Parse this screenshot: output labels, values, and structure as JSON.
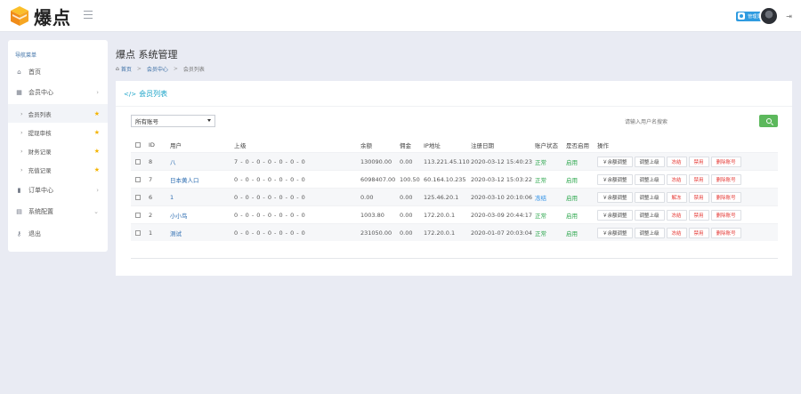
{
  "app": {
    "logo_text": "爆点",
    "colors": {
      "accent": "#1aa3c8",
      "primary_link": "#2a6bb0",
      "success": "#5cb85c",
      "star": "#f4b400",
      "danger": "#e53935"
    }
  },
  "header": {
    "user_badge": "管理员",
    "logout_icon": "logout-icon"
  },
  "sidebar": {
    "heading": "导航菜单",
    "items": [
      {
        "label": "首页",
        "icon": "home-icon"
      },
      {
        "label": "会员中心",
        "icon": "table-icon"
      },
      {
        "label": "会员列表",
        "sub": true
      },
      {
        "label": "提现审核",
        "sub": true
      },
      {
        "label": "财务记录",
        "sub": true
      },
      {
        "label": "充值记录",
        "sub": true
      },
      {
        "label": "订单中心",
        "icon": "chart-icon"
      },
      {
        "label": "系统配置",
        "icon": "settings-icon"
      },
      {
        "label": "退出",
        "icon": "key-icon"
      }
    ]
  },
  "main": {
    "page_title": "爆点 系统管理",
    "breadcrumb": [
      "首页",
      "会员中心",
      "会员列表"
    ]
  },
  "panel": {
    "title": "会员列表",
    "filter_value": "所有账号",
    "search_placeholder": "请输入用户名搜索"
  },
  "table": {
    "headers": [
      "ID",
      "用户",
      "上级",
      "余额",
      "佣金",
      "IP地址",
      "注册日期",
      "账户状态",
      "是否启用",
      "操作"
    ],
    "rows": [
      {
        "id": "8",
        "user": "八",
        "parent": "7 - 0 - 0 - 0 - 0 - 0 - 0",
        "balance": "130090.00",
        "commission": "0.00",
        "ip": "113.221.45.110",
        "date": "2020-03-12 15:40:23",
        "status": "正常",
        "enabled": "启用"
      },
      {
        "id": "7",
        "user": "日本黄人口",
        "parent": "0 - 0 - 0 - 0 - 0 - 0 - 0",
        "balance": "6098407.00",
        "commission": "100.50",
        "ip": "60.164.10.235",
        "date": "2020-03-12 15:03:22",
        "status": "正常",
        "enabled": "启用"
      },
      {
        "id": "6",
        "user": "1",
        "parent": "0 - 0 - 0 - 0 - 0 - 0 - 0",
        "balance": "0.00",
        "commission": "0.00",
        "ip": "125.46.20.1",
        "date": "2020-03-10 20:10:06",
        "status": "冻结",
        "enabled": "启用"
      },
      {
        "id": "2",
        "user": "小小鸟",
        "parent": "0 - 0 - 0 - 0 - 0 - 0 - 0",
        "balance": "1003.80",
        "commission": "0.00",
        "ip": "172.20.0.1",
        "date": "2020-03-09 20:44:17",
        "status": "正常",
        "enabled": "启用"
      },
      {
        "id": "1",
        "user": "测试",
        "parent": "0 - 0 - 0 - 0 - 0 - 0 - 0",
        "balance": "231050.00",
        "commission": "0.00",
        "ip": "172.20.0.1",
        "date": "2020-01-07 20:03:04",
        "status": "正常",
        "enabled": "启用"
      }
    ],
    "ops": [
      "￥余额调整",
      "调整上级",
      "冻结",
      "禁用",
      "删除账号"
    ],
    "ops_alt_row": [
      "￥余额调整",
      "调整上级",
      "解冻",
      "禁用",
      "删除账号"
    ]
  }
}
